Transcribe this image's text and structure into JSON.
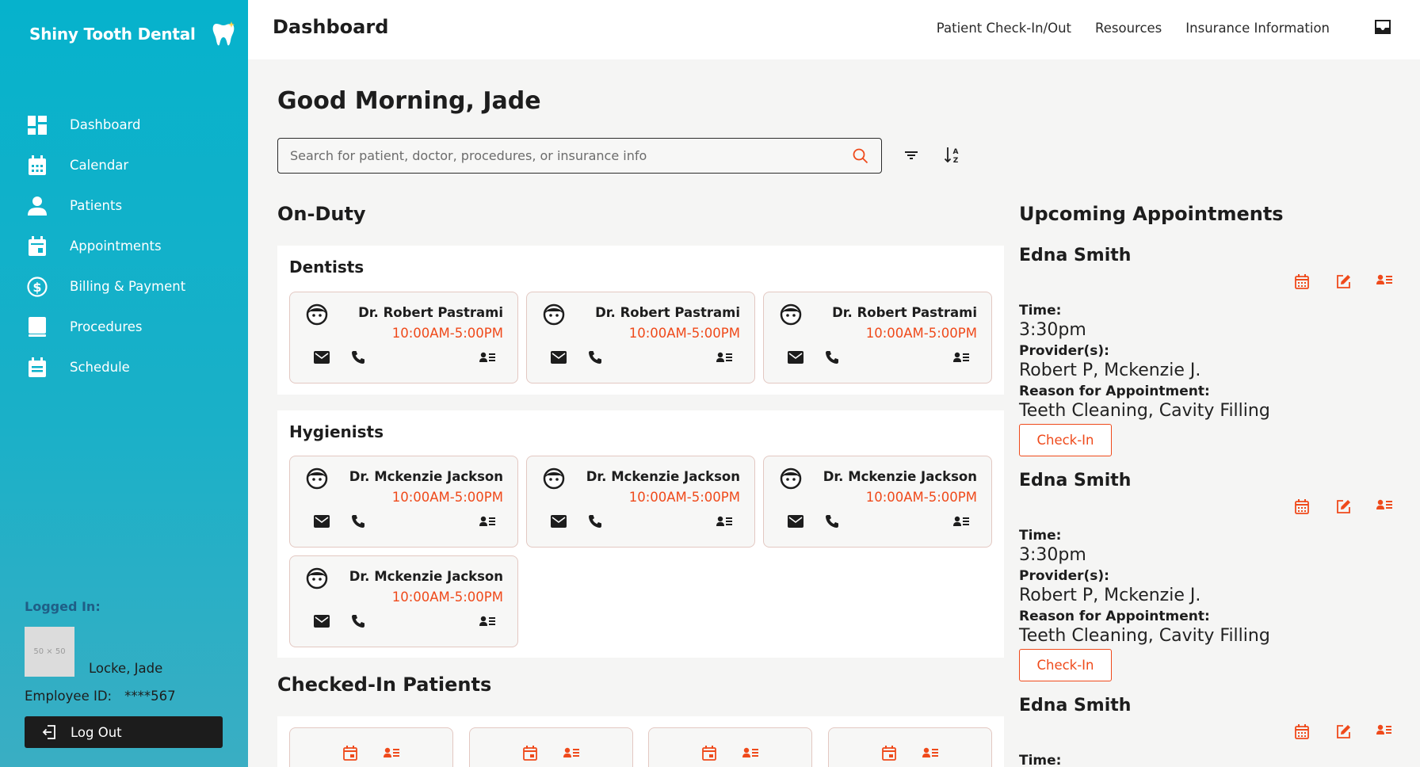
{
  "brand": {
    "name": "Shiny Tooth Dental",
    "icon": "tooth-icon"
  },
  "sidebar": {
    "items": [
      {
        "label": "Dashboard",
        "icon": "dashboard-icon"
      },
      {
        "label": "Calendar",
        "icon": "calendar-icon"
      },
      {
        "label": "Patients",
        "icon": "person-icon"
      },
      {
        "label": "Appointments",
        "icon": "appointment-icon"
      },
      {
        "label": "Billing & Payment",
        "icon": "dollar-icon"
      },
      {
        "label": "Procedures",
        "icon": "book-icon"
      },
      {
        "label": "Schedule",
        "icon": "schedule-icon"
      }
    ],
    "logged_in_label": "Logged In:",
    "avatar_placeholder": "50 × 50",
    "user_name": "Locke, Jade",
    "employee_id_label": "Employee ID:",
    "employee_id": "****567",
    "logout_label": "Log Out"
  },
  "header": {
    "title": "Dashboard",
    "links": [
      "Patient Check-In/Out",
      "Resources",
      "Insurance Information"
    ]
  },
  "main": {
    "greeting": "Good Morning, Jade",
    "search_placeholder": "Search for patient, doctor, procedures, or insurance info",
    "on_duty_title": "On-Duty",
    "dentists_title": "Dentists",
    "dentists": [
      {
        "name": "Dr. Robert Pastrami",
        "hours": "10:00AM-5:00PM"
      },
      {
        "name": "Dr. Robert Pastrami",
        "hours": "10:00AM-5:00PM"
      },
      {
        "name": "Dr. Robert Pastrami",
        "hours": "10:00AM-5:00PM"
      }
    ],
    "hygienists_title": "Hygienists",
    "hygienists": [
      {
        "name": "Dr. Mckenzie Jackson",
        "hours": "10:00AM-5:00PM"
      },
      {
        "name": "Dr. Mckenzie Jackson",
        "hours": "10:00AM-5:00PM"
      },
      {
        "name": "Dr. Mckenzie Jackson",
        "hours": "10:00AM-5:00PM"
      },
      {
        "name": "Dr. Mckenzie Jackson",
        "hours": "10:00AM-5:00PM"
      }
    ],
    "checked_in_title": "Checked-In Patients"
  },
  "upcoming": {
    "title": "Upcoming Appointments",
    "time_label": "Time:",
    "provider_label": "Provider(s):",
    "reason_label": "Reason for Appointment:",
    "checkin_label": "Check-In",
    "appointments": [
      {
        "name": "Edna Smith",
        "time": "3:30pm",
        "providers": "Robert P, Mckenzie J.",
        "reason": "Teeth Cleaning, Cavity Filling"
      },
      {
        "name": "Edna Smith",
        "time": "3:30pm",
        "providers": "Robert P, Mckenzie J.",
        "reason": "Teeth Cleaning, Cavity Filling"
      },
      {
        "name": "Edna Smith"
      }
    ]
  },
  "colors": {
    "sidebar": "#06b2cc",
    "accent": "#ef4a1b",
    "dark": "#1c1c1c"
  }
}
